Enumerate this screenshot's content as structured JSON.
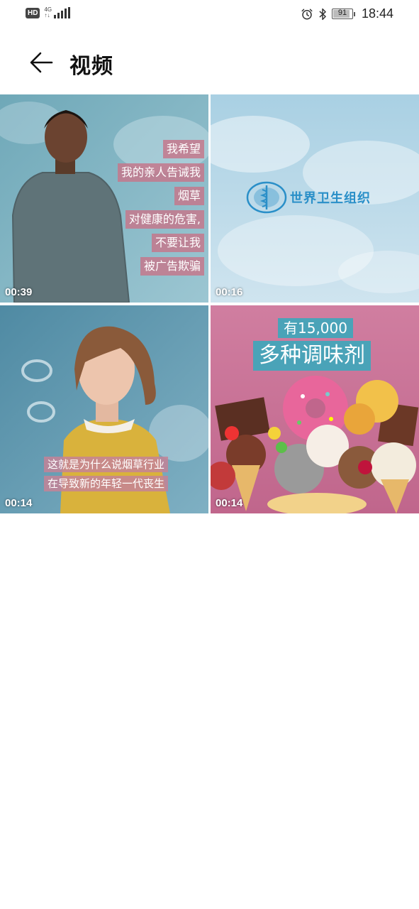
{
  "status_bar": {
    "hd": "HD",
    "network": "4G",
    "battery": "91",
    "battery_level": 0.91,
    "time": "18:44",
    "icons": [
      "hd-badge",
      "signal-icon",
      "alarm-icon",
      "bluetooth-icon",
      "battery-icon"
    ]
  },
  "header": {
    "back_icon": "arrow-left-icon",
    "title": "视频"
  },
  "videos": [
    {
      "duration": "00:39",
      "captions": [
        "我希望",
        "我的亲人告诫我",
        "烟草",
        "对健康的危害,",
        "不要让我",
        "被广告欺骗"
      ]
    },
    {
      "duration": "00:16",
      "logo_text": "世界卫生组织"
    },
    {
      "duration": "00:14",
      "captions": [
        "这就是为什么说烟草行业",
        "在导致新的年轻一代丧生"
      ]
    },
    {
      "duration": "00:14",
      "captions": [
        "有15,000",
        "多种调味剂"
      ]
    }
  ],
  "colors": {
    "caption_pink": "#c4788c",
    "who_blue": "#2a8fc8",
    "badge_teal": "#4aa3b8"
  }
}
